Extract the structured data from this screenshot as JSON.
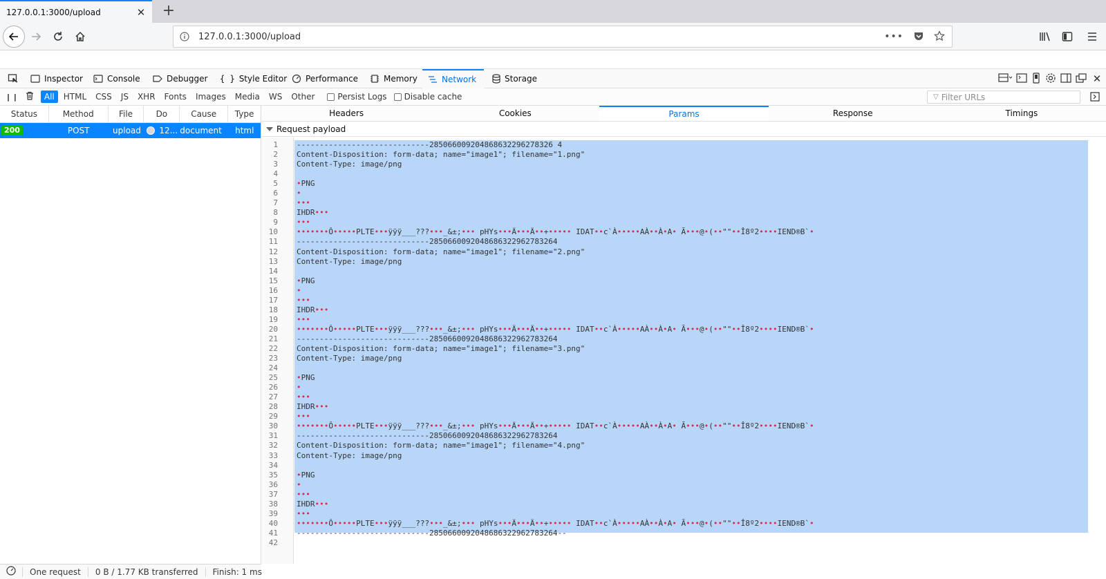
{
  "browser": {
    "tab_title": "127.0.0.1:3000/upload",
    "url": "127.0.0.1:3000/upload"
  },
  "devtools": {
    "tools": [
      "Inspector",
      "Console",
      "Debugger",
      "Style Editor",
      "Performance",
      "Memory",
      "Network",
      "Storage"
    ],
    "selected_tool": "Network"
  },
  "filterbar": {
    "types": [
      "All",
      "HTML",
      "CSS",
      "JS",
      "XHR",
      "Fonts",
      "Images",
      "Media",
      "WS",
      "Other"
    ],
    "selected_type": "All",
    "persist_logs": "Persist Logs",
    "disable_cache": "Disable cache",
    "filter_placeholder": "Filter URLs"
  },
  "request_list": {
    "columns": [
      "Status",
      "Method",
      "File",
      "Do",
      "Cause",
      "Type"
    ],
    "rows": [
      {
        "status": "200",
        "method": "POST",
        "file": "upload",
        "domain": "12...",
        "cause": "document",
        "type": "html"
      }
    ]
  },
  "footer": {
    "requests": "One request",
    "transferred": "0 B / 1.77 KB transferred",
    "finish": "Finish: 1 ms"
  },
  "details": {
    "tabs": [
      "Headers",
      "Cookies",
      "Params",
      "Response",
      "Timings"
    ],
    "selected_tab": "Params",
    "section_title": "Request payload",
    "lines": [
      "-----------------------------285066009204868632296278326 4",
      "Content-Disposition: form-data; name=\"image1\"; filename=\"1.png\"",
      "Content-Type: image/png",
      "",
      "•PNG",
      "•",
      "•••",
      "IHDR•••",
      "•••",
      "•••••••Ô•••••PLTE•••ÿÿÿ___???•••_&±;••• pHYs•••Ä•••Ä••+••••• IDAT••c`À•••••AÀ••À•A• Ã•••@•(••\"\"••Î8º2••••IEND®B`•",
      "-----------------------------2850660092048686322962783264",
      "Content-Disposition: form-data; name=\"image1\"; filename=\"2.png\"",
      "Content-Type: image/png",
      "",
      "•PNG",
      "•",
      "•••",
      "IHDR•••",
      "•••",
      "•••••••Ô•••••PLTE•••ÿÿÿ___???•••_&±;••• pHYs•••Ä•••Ä••+••••• IDAT••c`À•••••AÀ••À•A• Ã•••@•(••\"\"••Î8º2••••IEND®B`•",
      "-----------------------------2850660092048686322962783264",
      "Content-Disposition: form-data; name=\"image1\"; filename=\"3.png\"",
      "Content-Type: image/png",
      "",
      "•PNG",
      "•",
      "•••",
      "IHDR•••",
      "•••",
      "•••••••Ô•••••PLTE•••ÿÿÿ___???•••_&±;••• pHYs•••Ä•••Ä••+••••• IDAT••c`À•••••AÀ••À•A• Ã•••@•(••\"\"••Î8º2••••IEND®B`•",
      "-----------------------------2850660092048686322962783264",
      "Content-Disposition: form-data; name=\"image1\"; filename=\"4.png\"",
      "Content-Type: image/png",
      "",
      "•PNG",
      "•",
      "•••",
      "IHDR•••",
      "•••",
      "•••••••Ô•••••PLTE•••ÿÿÿ___???•••_&±;••• pHYs•••Ä•••Ä••+••••• IDAT••c`À•••••AÀ••À•A• Ã•••@•(••\"\"••Î8º2••••IEND®B`•",
      "-----------------------------2850660092048686322962783264--",
      ""
    ]
  },
  "colors": {
    "accent": "#0a84ff",
    "selected_text": "#0074e8",
    "status_ok": "#12bc00",
    "selection": "#b8d6f8",
    "control_char": "#e22850"
  }
}
